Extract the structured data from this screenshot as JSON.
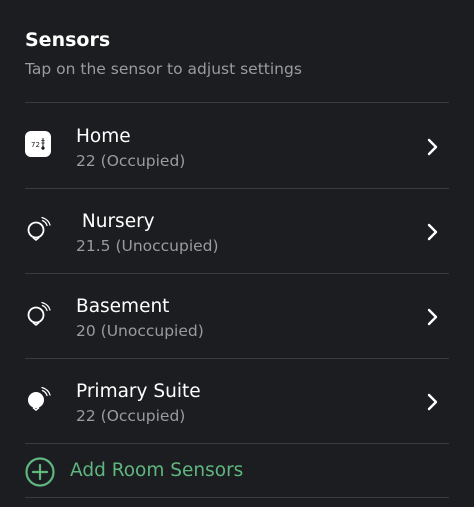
{
  "header": {
    "title": "Sensors",
    "subtitle": "Tap on the sensor to adjust settings"
  },
  "sensors": [
    {
      "name": "Home",
      "status": "22 (Occupied)",
      "icon": "thermostat-icon",
      "icon_text": "72"
    },
    {
      "name": " Nursery",
      "status": "21.5 (Unoccupied)",
      "icon": "room-sensor-outline-icon"
    },
    {
      "name": "Basement",
      "status": "20 (Unoccupied)",
      "icon": "room-sensor-outline-icon"
    },
    {
      "name": "Primary Suite",
      "status": "22 (Occupied)",
      "icon": "room-sensor-filled-icon"
    }
  ],
  "add_sensors": {
    "label": "Add Room Sensors",
    "icon": "plus-circle-icon"
  },
  "colors": {
    "background": "#1c1d21",
    "primary_text": "#ffffff",
    "secondary_text": "#9a9ba0",
    "divider": "#3a3b40",
    "accent_green": "#5fb67f"
  }
}
